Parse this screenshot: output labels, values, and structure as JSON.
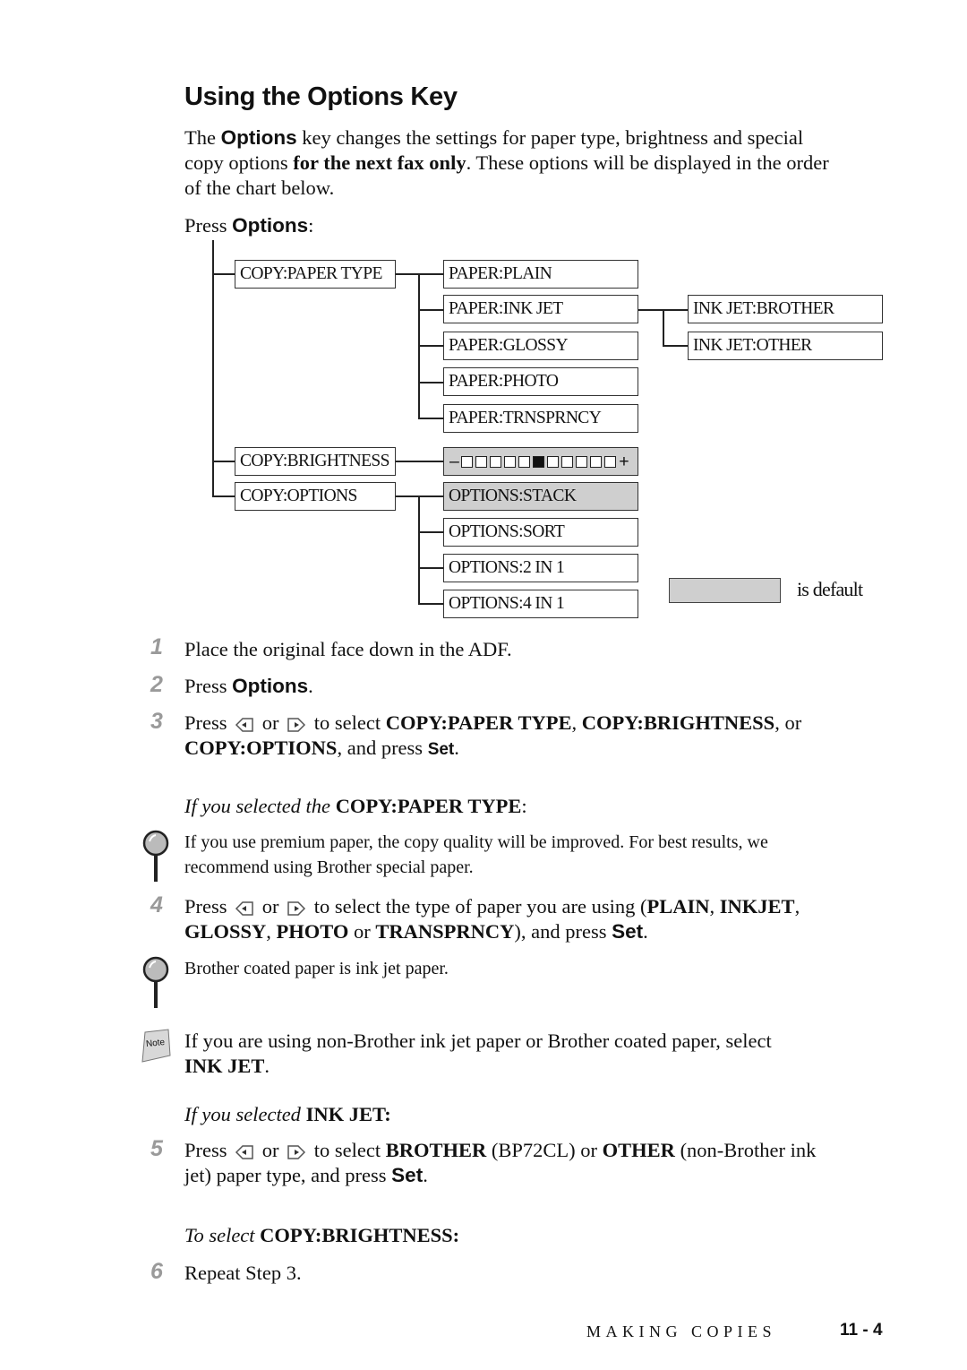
{
  "title": "Using the Options Key",
  "intro": {
    "t1": "The ",
    "b1": "Options",
    "t2": " key changes the settings for paper type, brightness and special",
    "t3": "copy options ",
    "b2": "for the next fax only",
    "t4": ". These options will be displayed in the order",
    "t5": "of the chart below."
  },
  "press_options": {
    "t1": "Press ",
    "b1": "Options",
    "t2": ":"
  },
  "menu_tree": {
    "level1": [
      "COPY:PAPER TYPE",
      "COPY:BRIGHTNESS",
      "COPY:OPTIONS"
    ],
    "paper_type": [
      "PAPER:PLAIN",
      "PAPER:INK JET",
      "PAPER:GLOSSY",
      "PAPER:PHOTO",
      "PAPER:TRNSPRNCY"
    ],
    "ink_jet": [
      "INK JET:BROTHER",
      "INK JET:OTHER"
    ],
    "brightness": {
      "minus": "–",
      "plus": "+",
      "levels": 11,
      "current_level": 6
    },
    "options": [
      "OPTIONS:STACK",
      "OPTIONS:SORT",
      "OPTIONS:2 IN 1",
      "OPTIONS:4 IN 1"
    ],
    "defaults": [
      "brightness",
      "OPTIONS:STACK"
    ],
    "legend_label": "is default",
    "default_color": "#cfcfcf"
  },
  "steps": {
    "s1": {
      "num": "1",
      "text": "Place the original face down in the ADF."
    },
    "s2": {
      "num": "2",
      "t1": "Press ",
      "b1": "Options",
      "t2": "."
    },
    "s3": {
      "num": "3",
      "t1": "Press",
      "or": "or",
      "t2": "to select ",
      "b1": "COPY:PAPER TYPE",
      "c1": ", ",
      "b2": "COPY:BRIGHTNESS",
      "c2": ", or",
      "b3": "COPY:OPTIONS",
      "t3": ", and press ",
      "b4": "Set",
      "t4": "."
    },
    "sub1": {
      "i": "If you selected the ",
      "b": "COPY:PAPER TYPE",
      "t": ":"
    },
    "tip1": {
      "l1": "If you use premium paper, the copy quality will be improved. For best results, we",
      "l2": "recommend using Brother special paper."
    },
    "s4": {
      "num": "4",
      "t1": "Press",
      "or": "or",
      "t2": "to select the type of paper you are using (",
      "b1": "PLAIN",
      "c1": ", ",
      "b2": "INKJET",
      "c2": ",",
      "b3": "GLOSSY",
      "c3": ", ",
      "b4": "PHOTO",
      "t3": " or ",
      "b5": "TRANSPRNCY",
      "t4": "), and press ",
      "b6": "Set",
      "t5": "."
    },
    "tip2": {
      "text": "Brother coated paper is ink jet paper."
    },
    "note": {
      "label": "Note",
      "t1": "If you are using non-Brother ink jet paper or Brother coated paper, select",
      "b1": "INK JET",
      "t2": "."
    },
    "sub2": {
      "i": "If you selected ",
      "b": "INK JET:"
    },
    "s5": {
      "num": "5",
      "t1": "Press",
      "or": "or",
      "t2": "to select ",
      "b1": "BROTHER",
      "t3": " (BP72CL) or ",
      "b2": "OTHER",
      "t4": " (non-Brother ink",
      "t5": "jet) paper type, and press ",
      "b3": "Set",
      "t6": "."
    },
    "sub3": {
      "i": "To select ",
      "b": "COPY:BRIGHTNESS:"
    },
    "s6": {
      "num": "6",
      "text": "Repeat Step 3."
    }
  },
  "footer": {
    "section": "MAKING COPIES",
    "page": "11 - 4"
  }
}
